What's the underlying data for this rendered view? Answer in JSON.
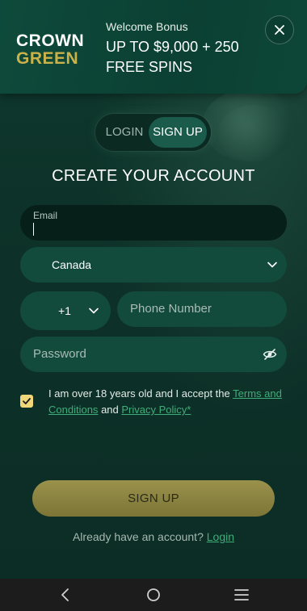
{
  "header": {
    "logo": {
      "line1": "CROWN",
      "line2": "GREEN"
    },
    "bonus_label": "Welcome Bonus",
    "bonus_offer_line1": "UP TO $9,000 + 250",
    "bonus_offer_line2": "FREE SPINS",
    "close_icon": "close-icon"
  },
  "tabs": [
    {
      "label": "LOGIN",
      "active": false
    },
    {
      "label": "SIGN UP",
      "active": true
    }
  ],
  "form": {
    "title": "CREATE YOUR ACCOUNT",
    "email_label": "Email",
    "email_value": "",
    "country_value": "Canada",
    "phone_code_value": "+1",
    "phone_placeholder": "Phone Number",
    "password_placeholder": "Password",
    "terms": {
      "checked": true,
      "text_before": "I am over 18 years old and I accept the",
      "terms_link": "Terms and Conditions",
      "and": "and",
      "privacy_link": "Privacy Policy*"
    },
    "submit_label": "SIGN UP",
    "already_text": "Already have an account?",
    "login_link": "Login"
  },
  "nav": {
    "back_icon": "back-icon",
    "home_icon": "home-icon",
    "menu_icon": "menu-icon"
  },
  "colors": {
    "background": "#0d2e26",
    "header": "#0e4a3b",
    "accent_gold": "#c9b24a",
    "link_green": "#3fae7a",
    "button_gold": "#9a914c"
  }
}
